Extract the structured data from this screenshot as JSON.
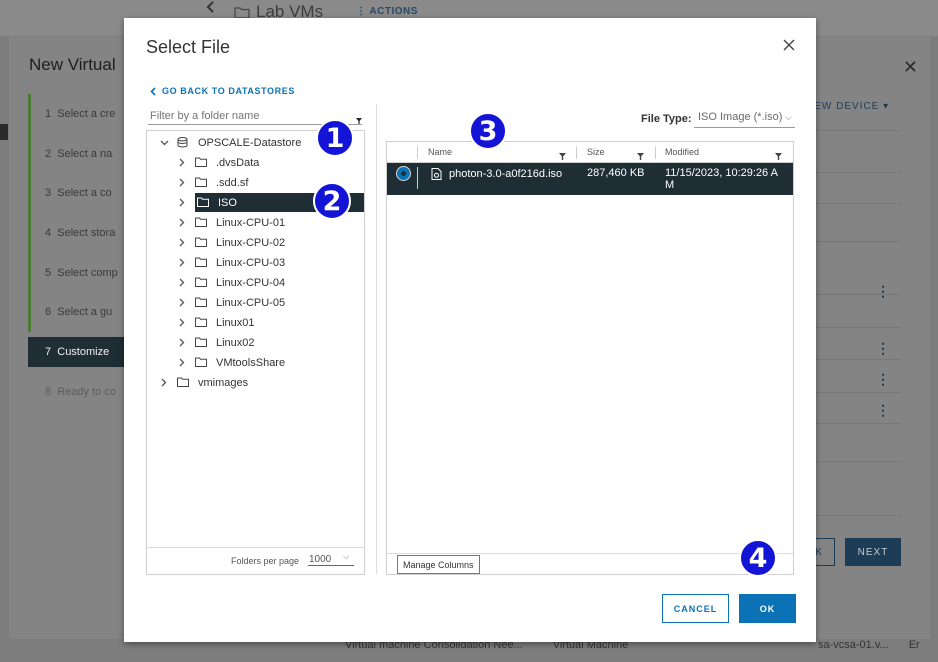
{
  "background": {
    "folder_title": "Lab VMs",
    "actions_label": "ACTIONS",
    "wizard_title": "New Virtual",
    "steps": [
      {
        "num": "1",
        "label": "Select a cre"
      },
      {
        "num": "2",
        "label": "Select a na"
      },
      {
        "num": "3",
        "label": "Select a co"
      },
      {
        "num": "4",
        "label": "Select stora"
      },
      {
        "num": "5",
        "label": "Select comp"
      },
      {
        "num": "6",
        "label": "Select a gu"
      },
      {
        "num": "7",
        "label": "Customize"
      },
      {
        "num": "8",
        "label": "Ready to co"
      }
    ],
    "new_device_label": "NEW DEVICE",
    "back_label": "CK",
    "next_label": "NEXT",
    "bottom_texts": [
      "Virtual machine Consolidation Nee...",
      "Virtual Machine",
      "sa-vcsa-01.v...",
      "Er"
    ]
  },
  "dialog": {
    "title": "Select File",
    "go_back_label": "GO BACK TO DATASTORES",
    "filter_placeholder": "Filter by a folder name",
    "tree": {
      "root": "OPSCALE-Datastore",
      "folders": [
        ".dvsData",
        ".sdd.sf",
        "ISO",
        "Linux-CPU-01",
        "Linux-CPU-02",
        "Linux-CPU-03",
        "Linux-CPU-04",
        "Linux-CPU-05",
        "Linux01",
        "Linux02",
        "VMtoolsShare"
      ],
      "selected": "ISO",
      "second_root": "vmimages"
    },
    "folders_per_page_label": "Folders per page",
    "folders_per_page_value": "1000",
    "file_type_label": "File Type:",
    "file_type_value": "ISO Image (*.iso)",
    "columns": [
      "Name",
      "Size",
      "Modified"
    ],
    "files": [
      {
        "name": "photon-3.0-a0f216d.iso",
        "size": "287,460 KB",
        "modified_line1": "11/15/2023, 10:29:26 A",
        "modified_line2": "M"
      }
    ],
    "manage_columns_label": "Manage Columns",
    "cancel_label": "CANCEL",
    "ok_label": "OK"
  },
  "annotations": [
    "1",
    "2",
    "3",
    "4"
  ],
  "colors": {
    "accent": "#0b72b5",
    "selected_row": "#1f2d35",
    "badge": "#1414d6"
  }
}
